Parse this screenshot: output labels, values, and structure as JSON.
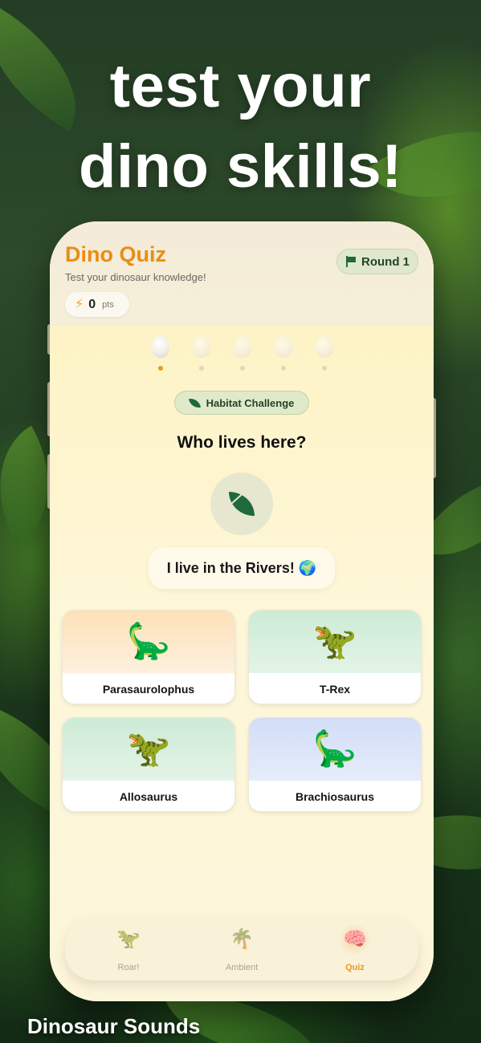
{
  "promo": {
    "headline_line1": "test your",
    "headline_line2": "dino skills!",
    "footer_caption": "Dinosaur Sounds"
  },
  "app": {
    "title": "Dino Quiz",
    "subtitle": "Test your dinosaur knowledge!",
    "title_color": "#ea8d14"
  },
  "round": {
    "label": "Round 1",
    "icon": "flag-icon"
  },
  "points": {
    "icon": "bolt-icon",
    "value": "0",
    "unit": "pts"
  },
  "progress": {
    "total": 5,
    "current": 1
  },
  "challenge": {
    "chip_label": "Habitat Challenge",
    "chip_icon": "leaf-icon",
    "question": "Who lives here?",
    "habitat_icon": "leaf-icon",
    "clue": "I live in the Rivers! 🌍"
  },
  "options": [
    {
      "name": "Parasaurolophus",
      "emoji": "🦕",
      "color": "orange"
    },
    {
      "name": "T-Rex",
      "emoji": "🦖",
      "color": "green"
    },
    {
      "name": "Allosaurus",
      "emoji": "🦖",
      "color": "green"
    },
    {
      "name": "Brachiosaurus",
      "emoji": "🦕",
      "color": "blue"
    }
  ],
  "tabs": [
    {
      "label": "Roar!",
      "icon": "🦖",
      "active": false
    },
    {
      "label": "Ambient",
      "icon": "🌴",
      "active": false
    },
    {
      "label": "Quiz",
      "icon": "🧠",
      "active": true
    }
  ],
  "colors": {
    "accent": "#ea8d14",
    "chip_green": "#dfe8cc",
    "dark_green": "#1f6a3d"
  }
}
